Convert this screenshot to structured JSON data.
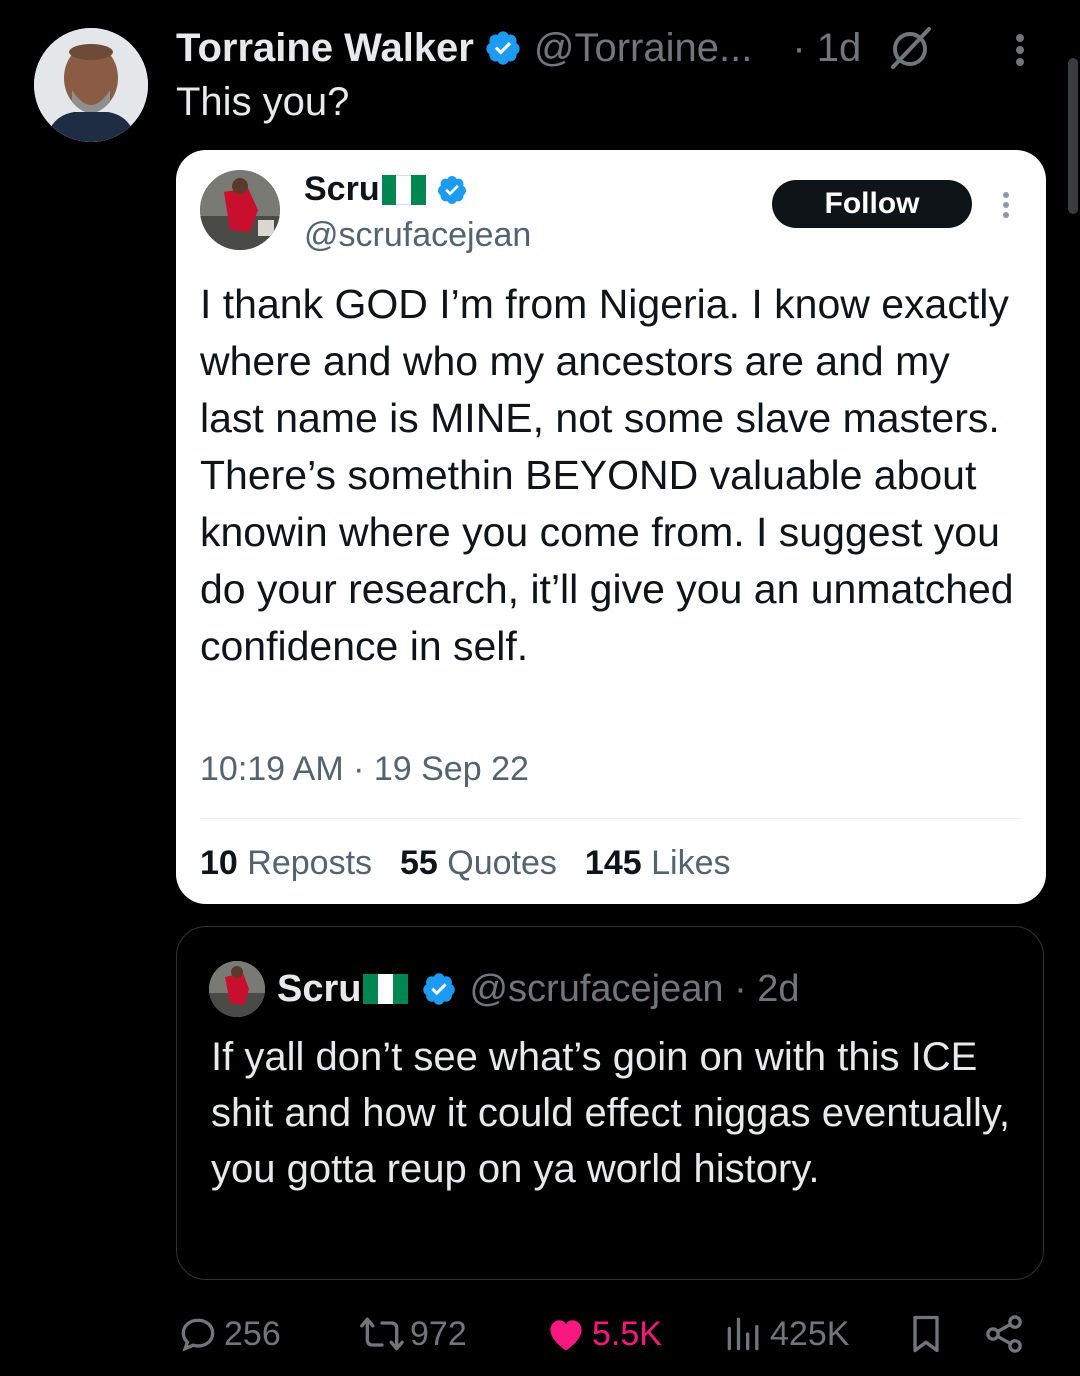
{
  "post": {
    "author_name": "Torraine Walker",
    "handle": "@Torraine...",
    "time": "· 1d",
    "text": "This you?"
  },
  "quoted": {
    "name": "Scru",
    "handle": "@scrufacejean",
    "follow_label": "Follow",
    "text": "I thank GOD I’m from Nigeria. I know exactly where and who my ancestors are and my last name is MINE, not some slave masters. There’s somethin BEYOND valuable about knowin where you come from. I suggest you do your research, it’ll give you an unmatched confidence in self.",
    "timestamp": "10:19 AM · 19 Sep 22",
    "stats": [
      {
        "count": "10",
        "label": "Reposts"
      },
      {
        "count": "55",
        "label": "Quotes"
      },
      {
        "count": "145",
        "label": "Likes"
      }
    ]
  },
  "embedded": {
    "name": "Scru",
    "handle": "@scrufacejean · 2d",
    "text": "If yall don’t see what’s goin on with this ICE shit and how it could effect niggas eventually, you gotta reup on ya world history."
  },
  "actions": {
    "replies": "256",
    "reposts": "972",
    "likes": "5.5K",
    "views": "425K"
  },
  "colors": {
    "background": "#000000",
    "verified": "#1d9bf0",
    "like": "#f91880",
    "flag_green": "#008751",
    "flag_white": "#ffffff"
  },
  "icons": [
    "verified-badge-icon",
    "grok-icon",
    "more-vertical-icon",
    "reply-icon",
    "repost-icon",
    "heart-icon",
    "views-icon",
    "bookmark-icon",
    "share-icon"
  ]
}
